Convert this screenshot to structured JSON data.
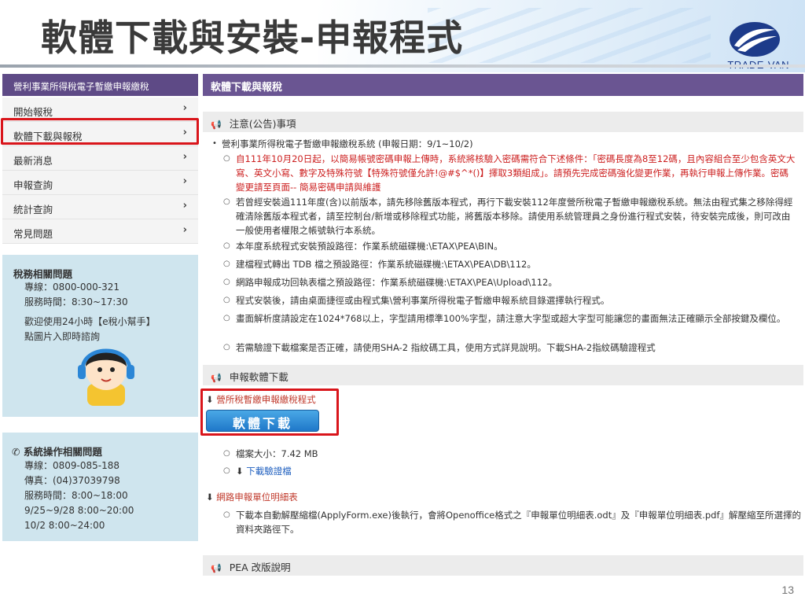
{
  "slide": {
    "title": "軟體下載與安裝-申報程式",
    "page_number": "13",
    "logo_text": "TRADE-VAN"
  },
  "sidebar": {
    "title": "營利事業所得稅電子暫繳申報繳稅",
    "items": [
      {
        "label": "開始報稅"
      },
      {
        "label": "軟體下載與報稅"
      },
      {
        "label": "最新消息"
      },
      {
        "label": "申報查詢"
      },
      {
        "label": "統計查詢"
      },
      {
        "label": "常見問題"
      }
    ]
  },
  "tax_box": {
    "title": "稅務相關問題",
    "lines": [
      "專線：0800-000-321",
      "服務時間：8:30~17:30",
      "歡迎使用24小時【e稅小幫手】",
      "點圖片入即時諮詢"
    ]
  },
  "system_box": {
    "title": "系統操作相關問題",
    "lines": [
      "專線：0809-085-188",
      "傳真：(04)37039798",
      "服務時間：8:00~18:00",
      "9/25~9/28 8:00~20:00",
      "10/2 8:00~24:00"
    ]
  },
  "main": {
    "title": "軟體下載與報稅",
    "notice_header": "注意(公告)事項",
    "notice_intro": "營利事業所得稅電子暫繳申報繳稅系統 (申報日期：9/1~10/2)",
    "notices": [
      "自111年10月20日起，以簡易帳號密碼申報上傳時，系統將核驗入密碼需符合下述條件：「密碼長度為8至12碼，且內容組合至少包含英文大寫、英文小寫、數字及特殊符號【特殊符號僅允許!@#$^*()】擇取3類組成」。請預先完成密碼強化變更作業，再執行申報上傳作業。密碼變更請至頁面-- 簡易密碼申請與維護",
      "若曾經安裝過111年度(含)以前版本，請先移除舊版本程式，再行下載安裝112年度營所稅電子暫繳申報繳稅系統。無法由程式集之移除得經確清除舊版本程式者，請至控制台/新增或移除程式功能，將舊版本移除。請使用系統管理員之身份進行程式安裝，待安裝完成後，則可改由一般使用者權限之帳號執行本系統。",
      "本年度系統程式安裝預設路徑：作業系統磁碟機:\\ETAX\\PEA\\BIN。",
      "建檔程式轉出 TDB 檔之預設路徑：作業系統磁碟機:\\ETAX\\PEA\\DB\\112。",
      "網路申報成功回執表檔之預設路徑：作業系統磁碟機:\\ETAX\\PEA\\Upload\\112。",
      "程式安裝後，請由桌面捷徑或由程式集\\營利事業所得稅電子暫繳申報系統目錄選擇執行程式。",
      "畫面解析度請設定在1024*768以上，字型請用標準100%字型，請注意大字型或超大字型可能讓您的畫面無法正確顯示全部按鍵及欄位。",
      "若需驗證下載檔案是否正確，請使用SHA-2 指紋碼工具，使用方式詳見說明。下載SHA-2指紋碼驗證程式"
    ],
    "download_header": "申報軟體下載",
    "download_title": "營所稅暫繳申報繳稅程式",
    "download_button": "軟體下載",
    "file_size": "檔案大小：7.42 MB",
    "verify_link": "下載驗證檔",
    "form_title": "網路申報單位明細表",
    "form_desc": "下載本自動解壓縮檔(ApplyForm.exe)後執行，會將Openoffice格式之『申報單位明細表.odt』及『申報單位明細表.pdf』解壓縮至所選擇的資料夾路徑下。",
    "pea_header": "PEA 改版說明"
  },
  "colors": {
    "purple_header": "#6a5592",
    "highlight_red": "#d9151b",
    "info_blue": "#cfe5ee",
    "button_blue": "#1f78c9"
  }
}
